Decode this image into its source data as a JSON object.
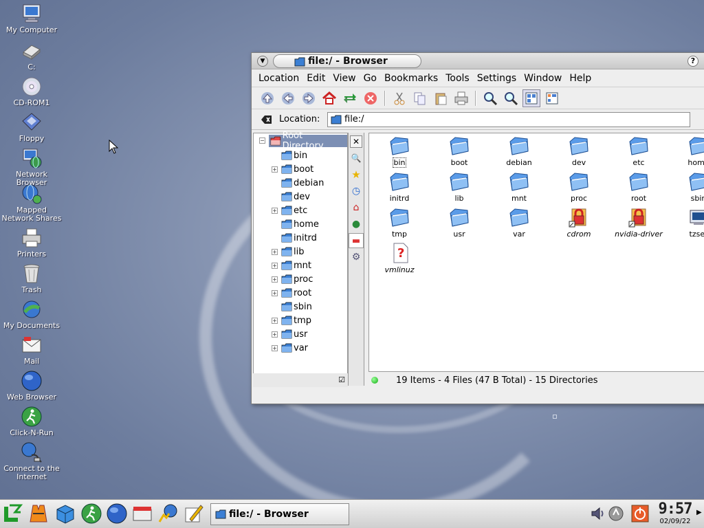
{
  "desktop": {
    "icons": [
      {
        "label": "My Computer",
        "icon": "computer-icon"
      },
      {
        "label": "C:",
        "icon": "harddisk-icon"
      },
      {
        "label": "CD-ROM1",
        "icon": "cdrom-icon"
      },
      {
        "label": "Floppy",
        "icon": "floppy-icon"
      },
      {
        "label": "Network Browser",
        "icon": "network-icon"
      },
      {
        "label": "Mapped Network Shares",
        "icon": "network-shares-icon"
      },
      {
        "label": "Printers",
        "icon": "printer-icon"
      },
      {
        "label": "Trash",
        "icon": "trash-icon"
      },
      {
        "label": "My Documents",
        "icon": "documents-icon"
      },
      {
        "label": "Mail",
        "icon": "mail-icon"
      },
      {
        "label": "Web Browser",
        "icon": "globe-icon"
      },
      {
        "label": "Click-N-Run",
        "icon": "runner-icon"
      },
      {
        "label": "Connect to the Internet",
        "icon": "connect-icon"
      }
    ]
  },
  "window": {
    "title": "file:/ - Browser",
    "help": "?",
    "menu": [
      "Location",
      "Edit",
      "View",
      "Go",
      "Bookmarks",
      "Tools",
      "Settings",
      "Window",
      "Help"
    ],
    "location_label": "Location:",
    "location_value": "file:/",
    "tree": {
      "root": "Root Directory",
      "items": [
        "bin",
        "boot",
        "debian",
        "dev",
        "etc",
        "home",
        "initrd",
        "lib",
        "mnt",
        "proc",
        "root",
        "sbin",
        "tmp",
        "usr",
        "var"
      ]
    },
    "files": [
      {
        "name": "bin",
        "type": "folder"
      },
      {
        "name": "boot",
        "type": "folder"
      },
      {
        "name": "debian",
        "type": "folder"
      },
      {
        "name": "dev",
        "type": "folder"
      },
      {
        "name": "etc",
        "type": "folder"
      },
      {
        "name": "home",
        "type": "folder"
      },
      {
        "name": "initrd",
        "type": "folder"
      },
      {
        "name": "lib",
        "type": "folder"
      },
      {
        "name": "mnt",
        "type": "folder"
      },
      {
        "name": "proc",
        "type": "folder"
      },
      {
        "name": "root",
        "type": "folder"
      },
      {
        "name": "sbin",
        "type": "folder"
      },
      {
        "name": "tmp",
        "type": "folder"
      },
      {
        "name": "usr",
        "type": "folder"
      },
      {
        "name": "var",
        "type": "folder"
      },
      {
        "name": "cdrom",
        "type": "link"
      },
      {
        "name": "nvidia-driver",
        "type": "link"
      },
      {
        "name": "tzset",
        "type": "app"
      },
      {
        "name": "vmlinuz",
        "type": "unknown"
      }
    ],
    "status": "19 Items - 4 Files (47 B Total)  -  15 Directories"
  },
  "taskbar": {
    "task_title": "file:/ - Browser",
    "time": "9:57",
    "date": "02/09/22"
  },
  "colors": {
    "folder": "#3b7fd4",
    "selection": "#7c8fb4"
  }
}
